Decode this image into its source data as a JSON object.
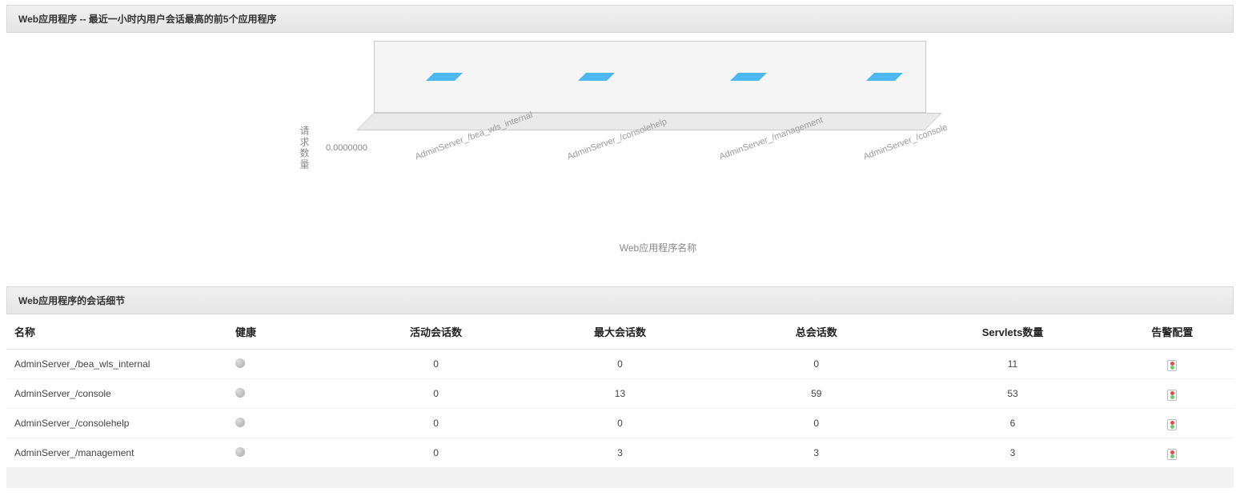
{
  "chart_panel": {
    "title": "Web应用程序 -- 最近一小时内用户会话最高的前5个应用程序"
  },
  "chart_data": {
    "type": "bar",
    "title": "",
    "ylabel": "请求数量",
    "xlabel": "Web应用程序名称",
    "y_tick": "0.0000000",
    "ylim": [
      0,
      0
    ],
    "categories": [
      "AdminServer_/bea_wls_internal",
      "AdminServer_/consolehelp",
      "AdminServer_/management",
      "AdminServer_/console"
    ],
    "values": [
      0,
      0,
      0,
      0
    ]
  },
  "table_panel": {
    "title": "Web应用程序的会话细节"
  },
  "table": {
    "headers": {
      "name": "名称",
      "health": "健康",
      "active": "活动会话数",
      "max": "最大会话数",
      "total": "总会话数",
      "servlets": "Servlets数量",
      "alert": "告警配置"
    },
    "rows": [
      {
        "name": "AdminServer_/bea_wls_internal",
        "active": "0",
        "max": "0",
        "total": "0",
        "servlets": "11"
      },
      {
        "name": "AdminServer_/console",
        "active": "0",
        "max": "13",
        "total": "59",
        "servlets": "53"
      },
      {
        "name": "AdminServer_/consolehelp",
        "active": "0",
        "max": "0",
        "total": "0",
        "servlets": "6"
      },
      {
        "name": "AdminServer_/management",
        "active": "0",
        "max": "3",
        "total": "3",
        "servlets": "3"
      }
    ]
  }
}
